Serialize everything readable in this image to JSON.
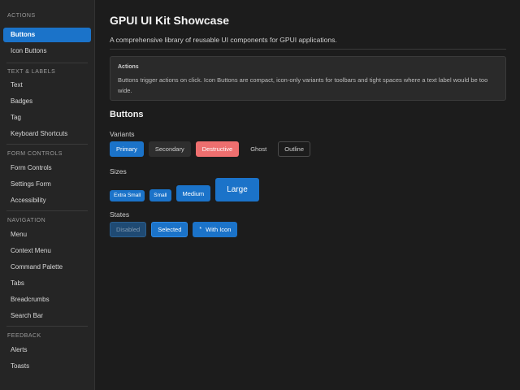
{
  "sidebar": {
    "sections": [
      {
        "title": "ACTIONS",
        "items": [
          "Buttons",
          "Icon Buttons"
        ]
      },
      {
        "title": "TEXT & LABELS",
        "items": [
          "Text",
          "Badges",
          "Tag",
          "Keyboard Shortcuts"
        ]
      },
      {
        "title": "FORM CONTROLS",
        "items": [
          "Form Controls",
          "Settings Form",
          "Accessibility"
        ]
      },
      {
        "title": "NAVIGATION",
        "items": [
          "Menu",
          "Context Menu",
          "Command Palette",
          "Tabs",
          "Breadcrumbs",
          "Search Bar"
        ]
      },
      {
        "title": "FEEDBACK",
        "items": [
          "Alerts",
          "Toasts"
        ]
      }
    ]
  },
  "page": {
    "title": "GPUI UI Kit Showcase",
    "subtitle": "A comprehensive library of reusable UI components for GPUI applications."
  },
  "callout": {
    "title": "Actions",
    "text": "Buttons trigger actions on click. Icon Buttons are compact, icon-only variants for toolbars and tight spaces where a text label would be too wide."
  },
  "section": {
    "title": "Buttons",
    "variants_label": "Variants",
    "sizes_label": "Sizes",
    "states_label": "States"
  },
  "variants": [
    "Primary",
    "Secondary",
    "Destructive",
    "Ghost",
    "Outline"
  ],
  "sizes": [
    "Extra Small",
    "Small",
    "Medium",
    "Large"
  ],
  "states": {
    "disabled": "Disabled",
    "selected": "Selected",
    "with_icon": "With Icon",
    "with_icon_glyph": "*"
  }
}
